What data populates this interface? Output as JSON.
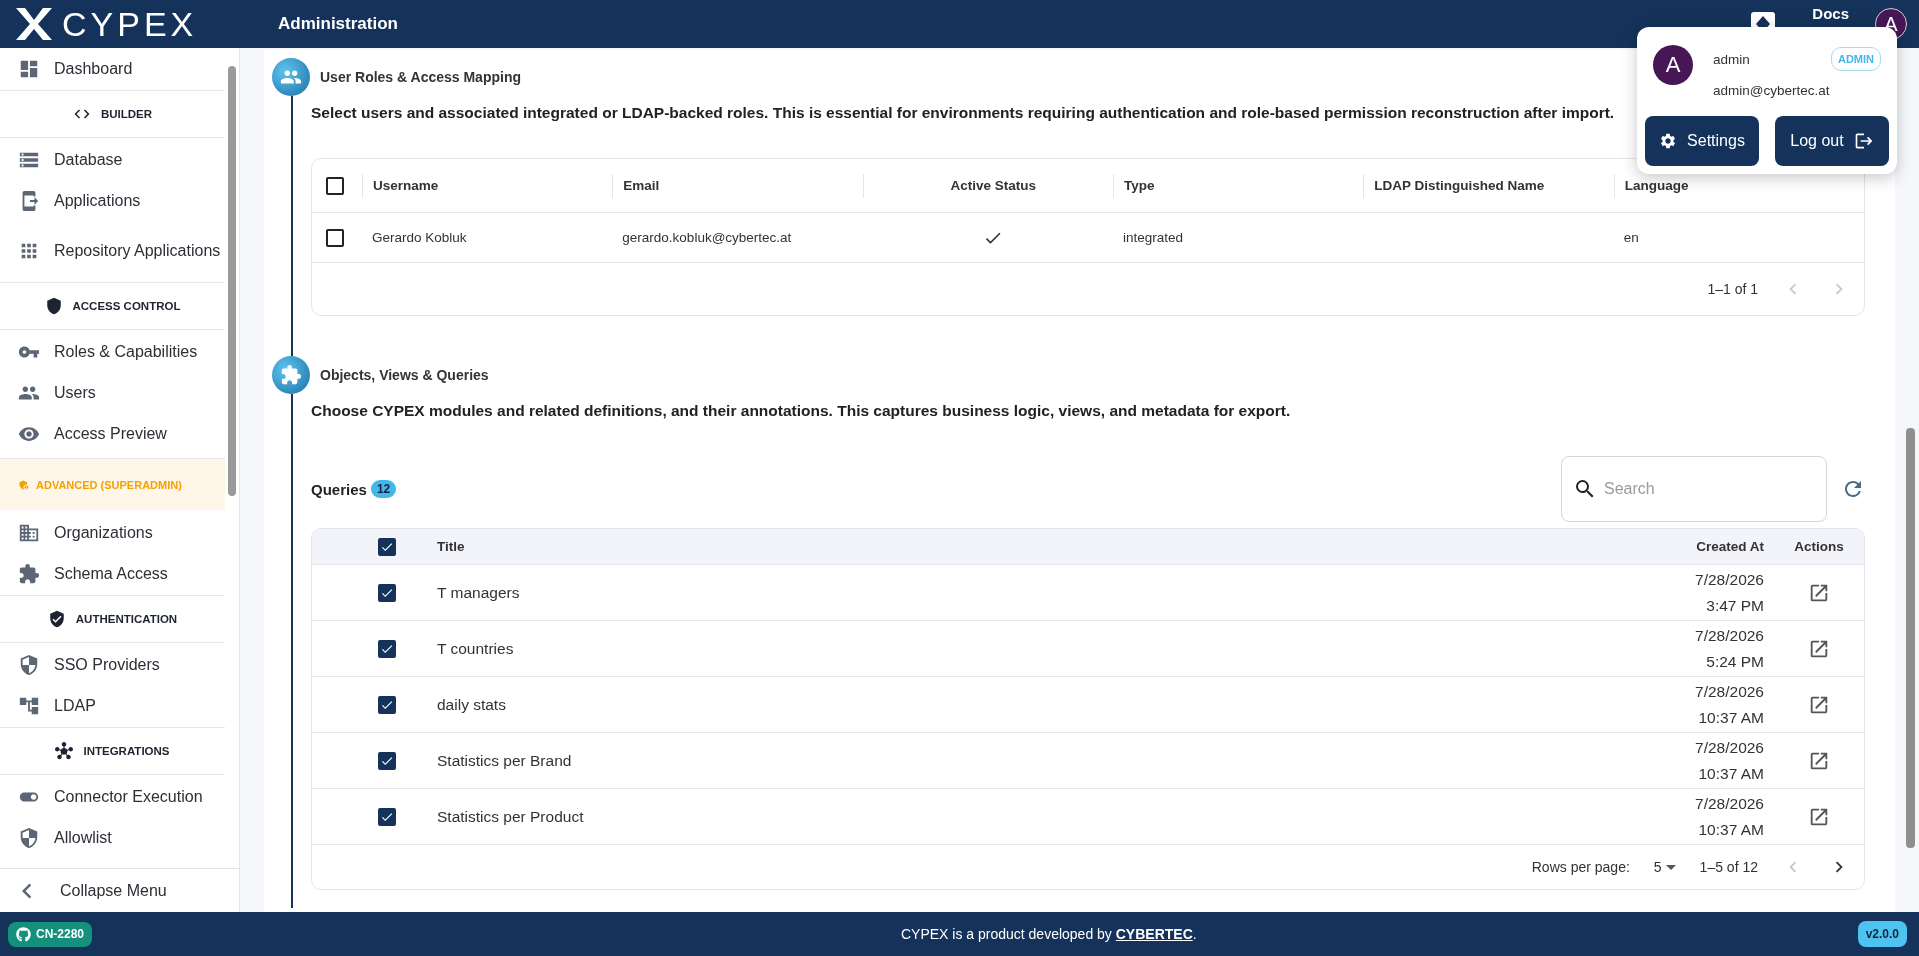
{
  "header": {
    "logo": "CYPEX",
    "title": "Administration",
    "docs": "Docs",
    "avatar": "A"
  },
  "sidebar": {
    "items": [
      {
        "kind": "link",
        "label": "Dashboard"
      },
      {
        "kind": "section",
        "label": "BUILDER"
      },
      {
        "kind": "link",
        "label": "Database"
      },
      {
        "kind": "link",
        "label": "Applications"
      },
      {
        "kind": "link",
        "label": "Repository Applications"
      },
      {
        "kind": "section",
        "label": "ACCESS CONTROL"
      },
      {
        "kind": "link",
        "label": "Roles & Capabilities"
      },
      {
        "kind": "link",
        "label": "Users"
      },
      {
        "kind": "link",
        "label": "Access Preview"
      },
      {
        "kind": "banner",
        "label": "ADVANCED (SUPERADMIN)"
      },
      {
        "kind": "link",
        "label": "Organizations"
      },
      {
        "kind": "link",
        "label": "Schema Access"
      },
      {
        "kind": "section",
        "label": "AUTHENTICATION"
      },
      {
        "kind": "link",
        "label": "SSO Providers"
      },
      {
        "kind": "link",
        "label": "LDAP"
      },
      {
        "kind": "section",
        "label": "INTEGRATIONS"
      },
      {
        "kind": "link",
        "label": "Connector Execution"
      },
      {
        "kind": "link",
        "label": "Allowlist"
      }
    ],
    "collapse": "Collapse Menu"
  },
  "user_roles": {
    "title": "User Roles & Access Mapping",
    "description": "Select users and associated integrated or LDAP-backed roles. This is essential for environments requiring authentication and role-based permission reconstruction after import.",
    "table": {
      "all_checked": false,
      "columns": [
        "Username",
        "Email",
        "Active Status",
        "Type",
        "LDAP Distinguished Name",
        "Language"
      ],
      "rows": [
        {
          "checked": false,
          "username": "Gerardo Kobluk",
          "email": "gerardo.kobluk@cybertec.at",
          "active": true,
          "type": "integrated",
          "language": "en"
        }
      ],
      "range": "1–1 of 1"
    }
  },
  "objects": {
    "title": "Objects, Views & Queries",
    "description": "Choose CYPEX modules and related definitions, and their annotations. This captures business logic, views, and metadata for export.",
    "queries": {
      "label": "Queries",
      "count": "12",
      "search": {
        "placeholder": "Search"
      },
      "all_checked": true,
      "columns": [
        "Title",
        "Created At",
        "Actions"
      ],
      "rows": [
        {
          "checked": true,
          "title": "T managers",
          "date": "7/28/2026",
          "time": "3:47 PM"
        },
        {
          "checked": true,
          "title": "T countries",
          "date": "7/28/2026",
          "time": "5:24 PM"
        },
        {
          "checked": true,
          "title": "daily stats",
          "date": "7/28/2026",
          "time": "10:37 AM"
        },
        {
          "checked": true,
          "title": "Statistics per Brand",
          "date": "7/28/2026",
          "time": "10:37 AM"
        },
        {
          "checked": true,
          "title": "Statistics per Product",
          "date": "7/28/2026",
          "time": "10:37 AM"
        }
      ],
      "rows_per_page_label": "Rows per page:",
      "rows_per_page": "5",
      "range": "1–5 of 12"
    }
  },
  "user_menu": {
    "avatar": "A",
    "name": "admin",
    "email": "admin@cybertec.at",
    "role": "ADMIN",
    "settings": "Settings",
    "logout": "Log out"
  },
  "footer": {
    "branch": "CN-2280",
    "text_before": "CYPEX is a product developed by ",
    "link": "CYBERTEC",
    "text_after": ".",
    "version": "v2.0.0"
  }
}
